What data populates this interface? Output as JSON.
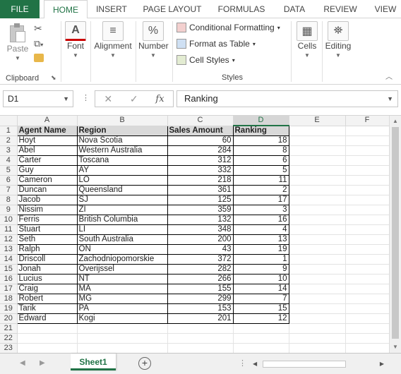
{
  "tabs": [
    {
      "label": "FILE"
    },
    {
      "label": "HOME"
    },
    {
      "label": "INSERT"
    },
    {
      "label": "PAGE LAYOUT"
    },
    {
      "label": "FORMULAS"
    },
    {
      "label": "DATA"
    },
    {
      "label": "REVIEW"
    },
    {
      "label": "VIEW"
    }
  ],
  "ribbon": {
    "clipboard": {
      "paste": "Paste",
      "label": "Clipboard"
    },
    "font": "Font",
    "alignment": "Alignment",
    "number": "Number",
    "styles": {
      "conditional": "Conditional Formatting",
      "format_table": "Format as Table",
      "cell_styles": "Cell Styles",
      "label": "Styles"
    },
    "cells": "Cells",
    "editing": "Editing"
  },
  "formula_bar": {
    "name_box": "D1",
    "formula": "Ranking",
    "fx": "fx"
  },
  "columns": [
    "A",
    "B",
    "C",
    "D",
    "E",
    "F"
  ],
  "header_row": [
    "Agent Name",
    "Region",
    "Sales Amount",
    "Ranking"
  ],
  "rows": [
    [
      "Hoyt",
      "Nova Scotia",
      "60",
      "18"
    ],
    [
      "Abel",
      "Western Australia",
      "284",
      "8"
    ],
    [
      "Carter",
      "Toscana",
      "312",
      "6"
    ],
    [
      "Guy",
      "AY",
      "332",
      "5"
    ],
    [
      "Cameron",
      "LO",
      "218",
      "11"
    ],
    [
      "Duncan",
      "Queensland",
      "361",
      "2"
    ],
    [
      "Jacob",
      "SJ",
      "125",
      "17"
    ],
    [
      "Nissim",
      "ZI",
      "359",
      "3"
    ],
    [
      "Ferris",
      "British Columbia",
      "132",
      "16"
    ],
    [
      "Stuart",
      "LI",
      "348",
      "4"
    ],
    [
      "Seth",
      "South Australia",
      "200",
      "13"
    ],
    [
      "Ralph",
      "ON",
      "43",
      "19"
    ],
    [
      "Driscoll",
      "Zachodniopomorskie",
      "372",
      "1"
    ],
    [
      "Jonah",
      "Overijssel",
      "282",
      "9"
    ],
    [
      "Lucius",
      "NT",
      "266",
      "10"
    ],
    [
      "Craig",
      "MA",
      "155",
      "14"
    ],
    [
      "Robert",
      "MG",
      "299",
      "7"
    ],
    [
      "Tarik",
      "PA",
      "153",
      "15"
    ],
    [
      "Edward",
      "Kogi",
      "201",
      "12"
    ]
  ],
  "row_numbers": [
    "1",
    "2",
    "3",
    "4",
    "5",
    "6",
    "7",
    "8",
    "9",
    "10",
    "11",
    "12",
    "13",
    "14",
    "15",
    "16",
    "17",
    "18",
    "19",
    "20",
    "21",
    "22",
    "23"
  ],
  "sheet_tab": "Sheet1"
}
